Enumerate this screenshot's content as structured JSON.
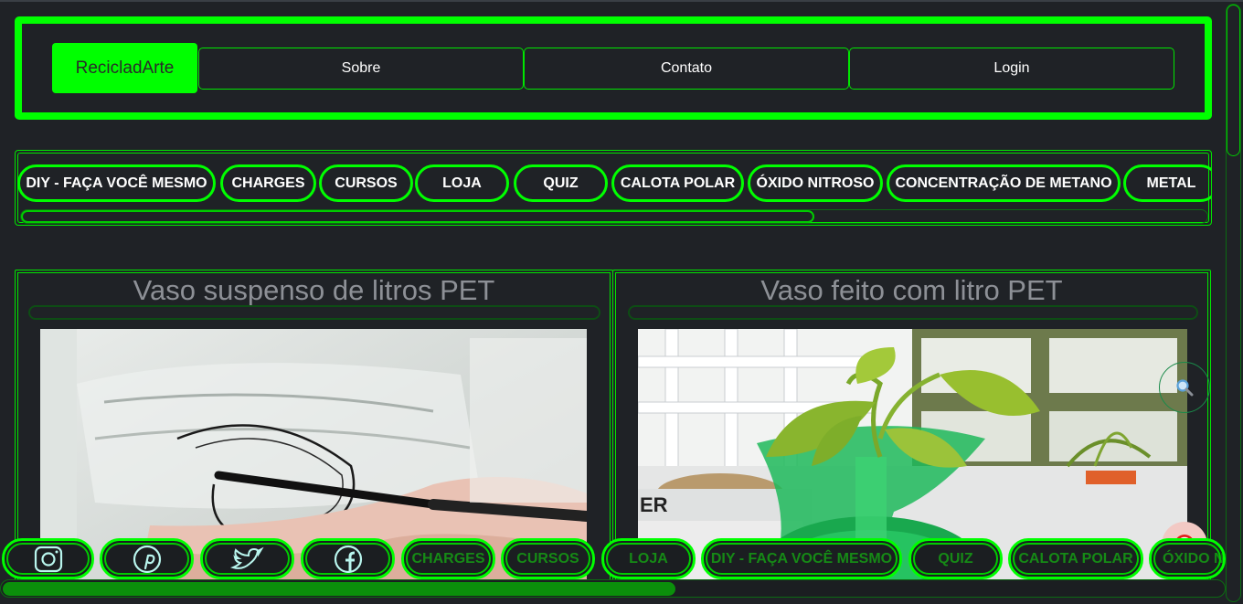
{
  "header": {
    "brand": "RecicladArte",
    "nav": [
      "Sobre",
      "Contato",
      "Login"
    ]
  },
  "categories": [
    "DIY - FAÇA VOCÊ MESMO",
    "CHARGES",
    "CURSOS",
    "LOJA",
    "QUIZ",
    "CALOTA POLAR",
    "ÓXIDO NITROSO",
    "CONCENTRAÇÃO DE METANO",
    "METAL"
  ],
  "cards": [
    {
      "title": "Vaso suspenso de litros PET"
    },
    {
      "title": "Vaso feito com litro PET"
    }
  ],
  "bottom_bar": {
    "social_icons": [
      "instagram-icon",
      "pinterest-icon",
      "twitter-icon",
      "facebook-icon"
    ],
    "links": [
      "CHARGES",
      "CURSOS",
      "LOJA",
      "DIY - FAÇA VOCÊ MESMO",
      "QUIZ",
      "CALOTA POLAR",
      "ÓXIDO NITROSO"
    ]
  },
  "colors": {
    "accent": "#00ff00",
    "background": "#1f2226",
    "title_gray": "#8d9096",
    "bottom_text": "#168a16"
  }
}
